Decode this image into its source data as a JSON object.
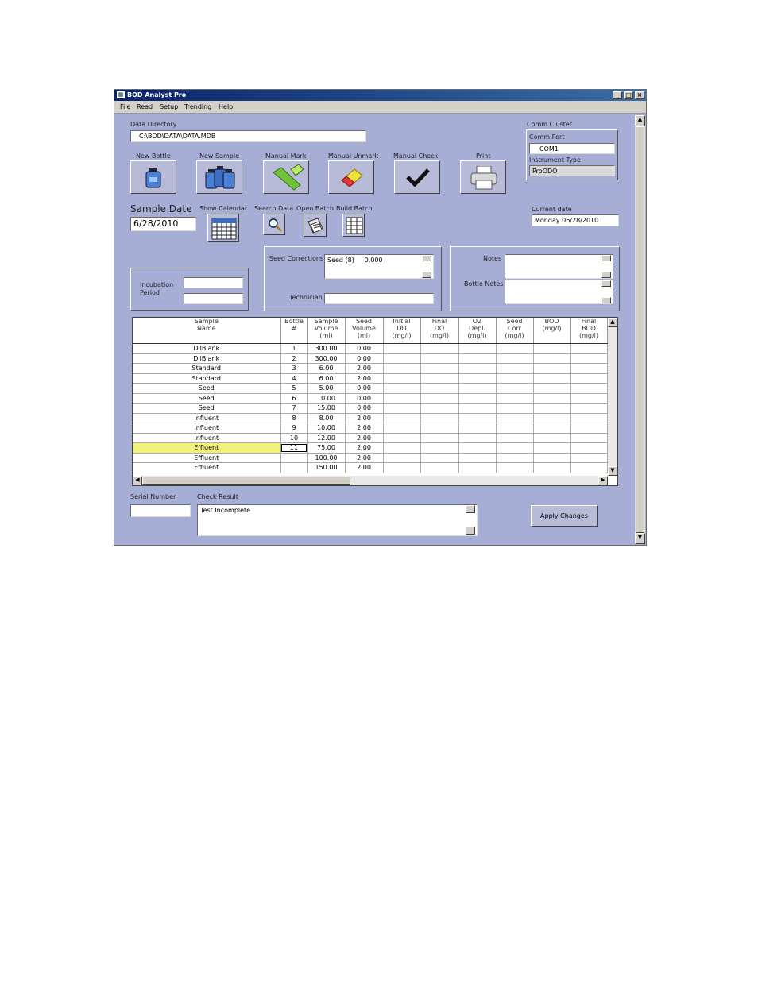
{
  "window": {
    "title": "BOD Analyst Pro"
  },
  "menu": [
    "File",
    "Read",
    "Setup",
    "Trending",
    "Help"
  ],
  "data_directory": {
    "label": "Data Directory",
    "value": "C:\\BOD\\DATA\\DATA.MDB"
  },
  "toolbar": {
    "new_bottle": "New Bottle",
    "new_sample": "New Sample",
    "manual_mark": "Manual Mark",
    "manual_unmark": "Manual Unmark",
    "manual_check": "Manual Check",
    "print": "Print"
  },
  "comm_cluster": {
    "label": "Comm Cluster",
    "comm_port_label": "Comm Port",
    "comm_port_value": "COM1",
    "instrument_type_label": "Instrument Type",
    "instrument_type_value": "ProODO"
  },
  "sample_date": {
    "label": "Sample Date",
    "value": "6/28/2010"
  },
  "show_calendar": "Show Calendar",
  "search_data": "Search Data",
  "open_batch": "Open Batch",
  "build_batch": "Build Batch",
  "current_date": {
    "label": "Current date",
    "value": "Monday 06/28/2010"
  },
  "incubation": {
    "label_line1": "Incubation",
    "label_line2": "Period"
  },
  "seed_corrections": {
    "label": "Seed Corrections",
    "value": "Seed (8)     0.000"
  },
  "technician": {
    "label": "Technician",
    "value": ""
  },
  "notes": {
    "label": "Notes",
    "value": ""
  },
  "bottle_notes": {
    "label": "Bottle Notes",
    "value": ""
  },
  "grid": {
    "columns": [
      [
        "Sample",
        "Name"
      ],
      [
        "Bottle",
        "#"
      ],
      [
        "Sample",
        "Volume",
        "(ml)"
      ],
      [
        "Seed",
        "Volume",
        "(ml)"
      ],
      [
        "Initial",
        "DO",
        "(mg/l)"
      ],
      [
        "Final",
        "DO",
        "(mg/l)"
      ],
      [
        "O2",
        "Depl.",
        "(mg/l)"
      ],
      [
        "Seed",
        "Corr",
        "(mg/l)"
      ],
      [
        "BOD",
        "(mg/l)"
      ],
      [
        "Final",
        "BOD",
        "(mg/l)"
      ]
    ],
    "rows": [
      [
        "DilBlank",
        "1",
        "300.00",
        "0.00"
      ],
      [
        "DilBlank",
        "2",
        "300.00",
        "0.00"
      ],
      [
        "Standard",
        "3",
        "6.00",
        "2.00"
      ],
      [
        "Standard",
        "4",
        "6.00",
        "2.00"
      ],
      [
        "Seed",
        "5",
        "5.00",
        "0.00"
      ],
      [
        "Seed",
        "6",
        "10.00",
        "0.00"
      ],
      [
        "Seed",
        "7",
        "15.00",
        "0.00"
      ],
      [
        "Influent",
        "8",
        "8.00",
        "2.00"
      ],
      [
        "Influent",
        "9",
        "10.00",
        "2.00"
      ],
      [
        "Influent",
        "10",
        "12.00",
        "2.00"
      ],
      [
        "Effluent",
        "11",
        "75.00",
        "2.00"
      ],
      [
        "Effluent",
        "",
        "100.00",
        "2.00"
      ],
      [
        "Effluent",
        "",
        "150.00",
        "2.00"
      ]
    ],
    "selected_row": 10,
    "highlight_color": "#f0f07a"
  },
  "serial_number": {
    "label": "Serial Number",
    "value": ""
  },
  "check_result": {
    "label": "Check Result",
    "value": "Test Incomplete"
  },
  "apply_button": "Apply Changes"
}
